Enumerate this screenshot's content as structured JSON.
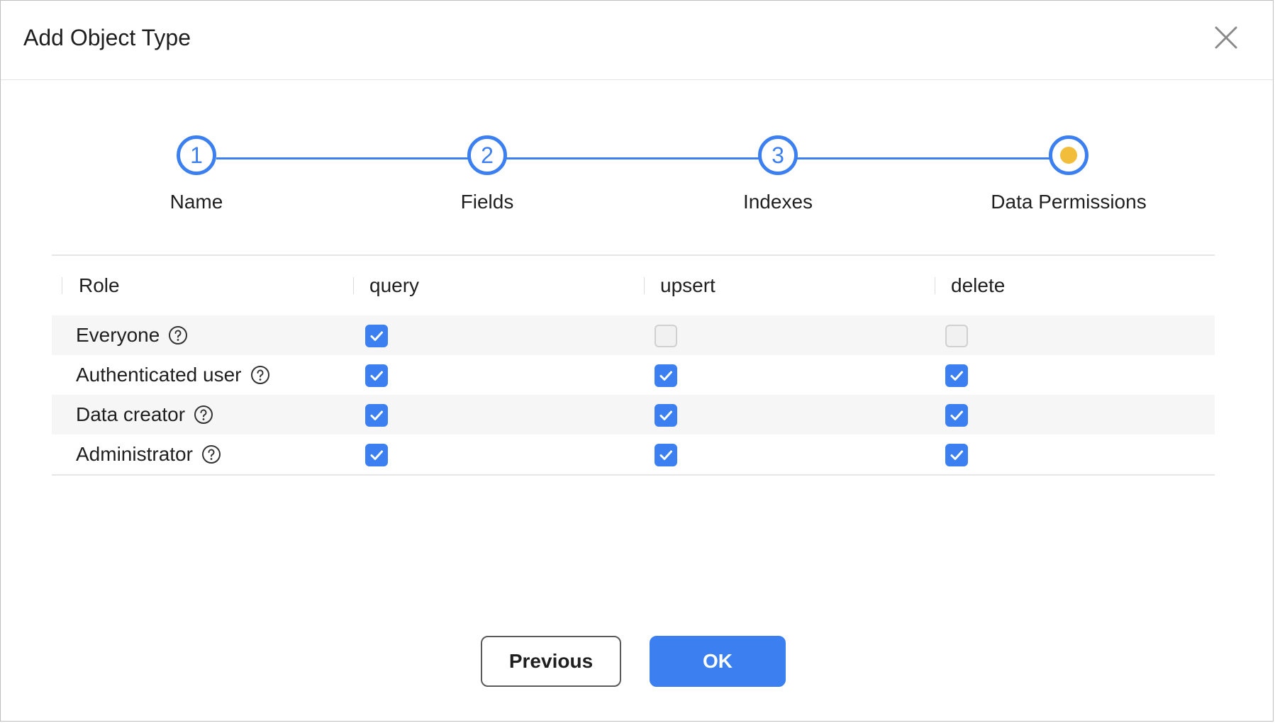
{
  "dialog": {
    "title": "Add Object Type"
  },
  "stepper": {
    "steps": [
      {
        "number": "1",
        "label": "Name",
        "state": "done"
      },
      {
        "number": "2",
        "label": "Fields",
        "state": "done"
      },
      {
        "number": "3",
        "label": "Indexes",
        "state": "done"
      },
      {
        "number": "",
        "label": "Data Permissions",
        "state": "current"
      }
    ]
  },
  "table": {
    "columns": [
      "Role",
      "query",
      "upsert",
      "delete"
    ],
    "rows": [
      {
        "role": "Everyone",
        "query": true,
        "upsert": false,
        "delete": false
      },
      {
        "role": "Authenticated user",
        "query": true,
        "upsert": true,
        "delete": true
      },
      {
        "role": "Data creator",
        "query": true,
        "upsert": true,
        "delete": true
      },
      {
        "role": "Administrator",
        "query": true,
        "upsert": true,
        "delete": true
      }
    ]
  },
  "footer": {
    "previous_label": "Previous",
    "ok_label": "OK"
  },
  "icons": {
    "close": "close-icon",
    "help": "question-circle-icon",
    "check": "check-icon"
  },
  "colors": {
    "accent": "#3b7ff0",
    "current_step_dot": "#f2bd3b",
    "row_shade": "#f6f6f6"
  }
}
